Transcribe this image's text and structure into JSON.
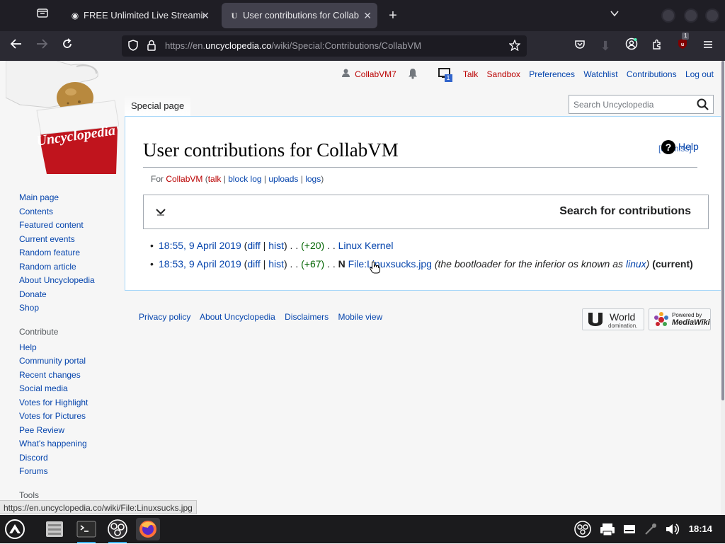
{
  "browser": {
    "tabs": [
      {
        "title": "FREE Unlimited Live Streamin",
        "active": false
      },
      {
        "title": "User contributions for Collab",
        "active": true
      }
    ],
    "new_tab_label": "+",
    "url": {
      "prefix": "https://en.",
      "host": "uncyclopedia.co",
      "path": "/wiki/Special:Contributions/CollabVM"
    },
    "extension_badge": "1"
  },
  "site": {
    "personal": {
      "username": "CollabVM7",
      "notifications_count": "1",
      "links": [
        "Talk",
        "Sandbox",
        "Preferences",
        "Watchlist",
        "Contributions",
        "Log out"
      ]
    },
    "tab_special_label": "Special page",
    "search_placeholder": "Search Uncyclopedia",
    "heading": "User contributions for CollabVM",
    "help_label": "Help",
    "help_label_overlap": "[dismiss]",
    "subtitle": {
      "for": "For ",
      "user": "CollabVM",
      "open_paren": " (",
      "talk": "talk",
      "sep1": " | ",
      "block_log": "block log",
      "sep2": " | ",
      "uploads": "uploads",
      "sep3": " | ",
      "logs": "logs",
      "close_paren": ")"
    },
    "search_contributions_label": "Search for contributions",
    "contributions": [
      {
        "timestamp": "18:55, 9 April 2019",
        "diff": "diff",
        "hist": "hist",
        "size_change": "(+20)",
        "new_flag": "",
        "page": "Linux Kernel",
        "comment": "",
        "current": ""
      },
      {
        "timestamp": "18:53, 9 April 2019",
        "diff": "diff",
        "hist": "hist",
        "size_change": "(+67)",
        "new_flag": "N",
        "page": "File:Linuxsucks.jpg",
        "comment_pre": "(the bootloader for the inferior os known as ",
        "comment_link": "linux",
        "comment_post": ")",
        "current": "(current)"
      }
    ],
    "footer_links": [
      "Privacy policy",
      "About Uncyclopedia",
      "Disclaimers",
      "Mobile view"
    ],
    "badges": {
      "world_line1": "World",
      "world_line2": "domination.",
      "mw_line1": "Powered by",
      "mw_line2": "MediaWiki"
    },
    "sidebar": {
      "navigation": [
        "Main page",
        "Contents",
        "Featured content",
        "Current events",
        "Random feature",
        "Random article",
        "About Uncyclopedia",
        "Donate",
        "Shop"
      ],
      "contribute_heading": "Contribute",
      "contribute": [
        "Help",
        "Community portal",
        "Recent changes",
        "Social media",
        "Votes for Highlight",
        "Votes for Pictures",
        "Pee Review",
        "What's happening",
        "Discord",
        "Forums"
      ],
      "tools_heading": "Tools"
    },
    "status_url": "https://en.uncyclopedia.co/wiki/File:Linuxsucks.jpg"
  },
  "taskbar": {
    "clock": "18:14"
  },
  "colors": {
    "link": "#0645ad",
    "redlink": "#ba0000",
    "positive": "#006400",
    "chrome_dark": "#1f1e25",
    "chrome_nav": "#2b2a33"
  }
}
